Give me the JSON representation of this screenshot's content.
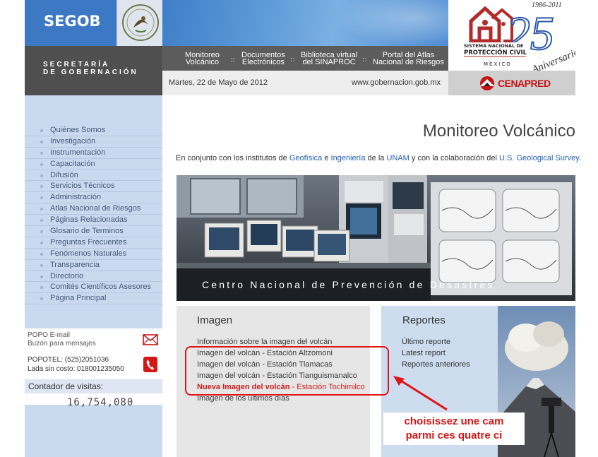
{
  "header": {
    "brand": "SEGOB",
    "secretaria_line1": "SECRETARÍA",
    "secretaria_line2": "DE GOBERNACIÓN",
    "nav": [
      {
        "line1": "Monitoreo",
        "line2": "Volcánico"
      },
      {
        "line1": "Documentos",
        "line2": "Electrónicos"
      },
      {
        "line1": "Biblioteca virtual",
        "line2": "del SINAPROC"
      },
      {
        "line1": "Portal del Atlas",
        "line2": "Nacional de Riesgos"
      }
    ],
    "nav_separator": "::",
    "date": "Martes, 22 de Mayo de 2012",
    "url": "www.gobernacion.gob.mx",
    "pc_logo": {
      "years": "1986-2011",
      "number": "25",
      "anniversary": "Aniversario",
      "line1": "SISTEMA NACIONAL DE",
      "line2": "PROTECCIÓN CIVIL",
      "country": "MÉXICO"
    },
    "cenapred": "CENAPRED"
  },
  "sidebar": {
    "menu": [
      "Quiénes Somos",
      "Investigación",
      "Instrumentación",
      "Capacitación",
      "Difusión",
      "Servicios Técnicos",
      "Administración",
      "Atlas Nacional de Riesgos",
      "Páginas Relacionadas",
      "Glosario de Terminos",
      "Preguntas Frecuentes",
      "Fenómenos Naturales",
      "Transparencia",
      "Directorio",
      "Comités Científicos Asesores",
      "Página Principal"
    ],
    "popo_email": "POPO E-mail",
    "buzon": "Buzón para mensajes",
    "popotel": "POPOTEL: (525)2051036",
    "lada": "Lada sin costo: 018001235050",
    "counter_title": "Contador de visitas:",
    "counter_value": "16,754,080"
  },
  "main": {
    "title": "Monitoreo Volcánico",
    "intro": {
      "t1": "En conjunto con los institutos de ",
      "l1": "Geofísica",
      "t2": " e ",
      "l2": "Ingeniería",
      "t3": " de la ",
      "l3": "UNAM",
      "t4": " y con la colaboración del ",
      "l4": "U.S. Geological Survey",
      "t5": "."
    },
    "hero_caption": "Centro Nacional de Prevención de Desastres",
    "imagen": {
      "heading": "Imagen",
      "info": "Información sobre la imagen del volcán",
      "links": [
        "Imagen del volcán - Estación Altzomoni",
        "Imagen del volcán - Estación Tlamacas",
        "Imagen del volcán - Estación Tianguismanalco"
      ],
      "new_bold": "Nueva Imagen del volcán",
      "new_rest": " - Estación Tochimilco",
      "last": "Imagen de los últimos días"
    },
    "reportes": {
      "heading": "Reportes",
      "links": [
        "Último reporte",
        "Latest report",
        "Reportes anteriores"
      ]
    }
  },
  "annotation": {
    "line1": "choisissez une cam",
    "line2": "parmi ces quatre ci",
    "color": "#d41616"
  }
}
